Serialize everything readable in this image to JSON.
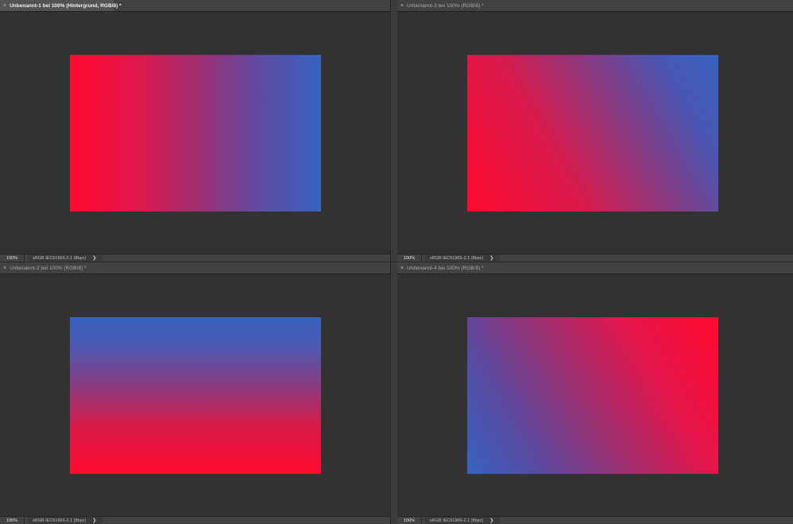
{
  "panes": [
    {
      "tab_label": "Unbenannt-1 bei 100% (Hintergrund, RGB/8) *",
      "active": true,
      "gradient": "linear-gradient(90deg, #ff0a2e 0%, #e4154a 25%, #a02e6e 50%, #5f4ca0 75%, #3762c0 100%)",
      "zoom": "100%",
      "profile": "sRGB IEC61966-2.1 (8bpc)"
    },
    {
      "tab_label": "Unbenannt-3 bei 100% (RGB/8) *",
      "active": false,
      "gradient": "linear-gradient(60deg, #ff0a2e 0%, #d81a4c 35%, #8a3a80 60%, #4a56b2 82%, #3762c0 100%)",
      "zoom": "100%",
      "profile": "sRGB IEC61966-2.1 (8bpc)"
    },
    {
      "tab_label": "Unbenannt-2 bei 100% (RGB/8) *",
      "active": false,
      "gradient": "linear-gradient(180deg, #3762c0 0%, #4f58ae 20%, #8e3a7e 45%, #d81a48 70%, #ff0a2e 100%)",
      "zoom": "100%",
      "profile": "sRGB IEC61966-2.1 (8bpc)"
    },
    {
      "tab_label": "Unbenannt-4 bei 100% (RGB/8) *",
      "active": false,
      "gradient": "linear-gradient(60deg, #3762c0 0%, #5a4aa0 22%, #a02e6e 48%, #e4154a 72%, #ff0a2e 100%)",
      "zoom": "100%",
      "profile": "sRGB IEC61966-2.1 (8bpc)"
    }
  ],
  "colors": {
    "workspace": "#323232",
    "tabbar": "#424242",
    "gradient_red": "#ff0a2e",
    "gradient_blue": "#3762c0"
  }
}
